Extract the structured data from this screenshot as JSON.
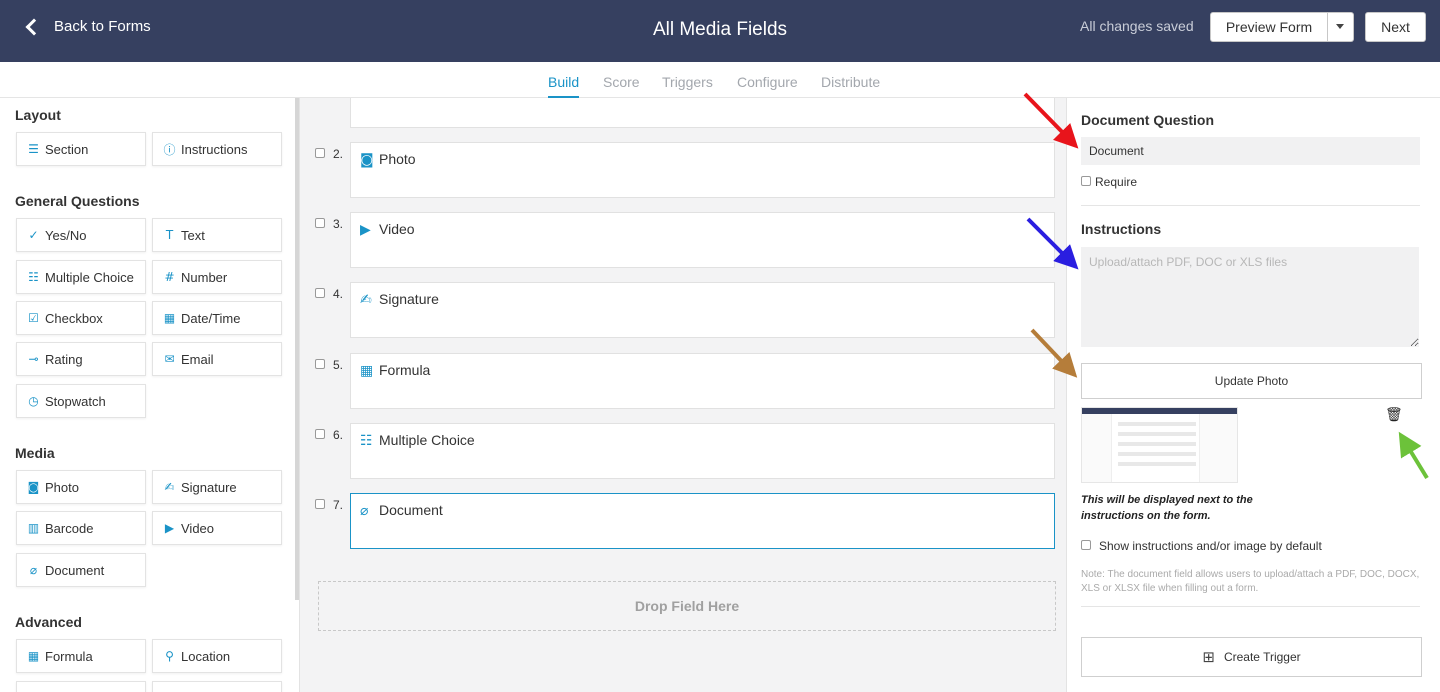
{
  "header": {
    "back_label": "Back to Forms",
    "title": "All Media Fields",
    "status": "All changes saved",
    "preview_label": "Preview Form",
    "next_label": "Next"
  },
  "tabs": [
    {
      "label": "Build",
      "active": true
    },
    {
      "label": "Score",
      "active": false
    },
    {
      "label": "Triggers",
      "active": false
    },
    {
      "label": "Configure",
      "active": false
    },
    {
      "label": "Distribute",
      "active": false
    }
  ],
  "sidebar": {
    "sections": [
      {
        "title": "Layout",
        "items": [
          {
            "label": "Section",
            "icon": "section-icon"
          },
          {
            "label": "Instructions",
            "icon": "info-icon"
          }
        ]
      },
      {
        "title": "General Questions",
        "items": [
          {
            "label": "Yes/No",
            "icon": "yes-no-icon"
          },
          {
            "label": "Text",
            "icon": "text-icon"
          },
          {
            "label": "Multiple Choice",
            "icon": "list-icon"
          },
          {
            "label": "Number",
            "icon": "hash-icon"
          },
          {
            "label": "Checkbox",
            "icon": "checkbox-icon"
          },
          {
            "label": "Date/Time",
            "icon": "calendar-icon"
          },
          {
            "label": "Rating",
            "icon": "rating-icon"
          },
          {
            "label": "Email",
            "icon": "email-icon"
          },
          {
            "label": "Stopwatch",
            "icon": "stopwatch-icon"
          }
        ]
      },
      {
        "title": "Media",
        "items": [
          {
            "label": "Photo",
            "icon": "camera-icon"
          },
          {
            "label": "Signature",
            "icon": "signature-icon"
          },
          {
            "label": "Barcode",
            "icon": "barcode-icon"
          },
          {
            "label": "Video",
            "icon": "video-icon"
          },
          {
            "label": "Document",
            "icon": "paperclip-icon"
          }
        ]
      },
      {
        "title": "Advanced",
        "items": [
          {
            "label": "Formula",
            "icon": "formula-icon"
          },
          {
            "label": "Location",
            "icon": "location-icon"
          }
        ]
      }
    ]
  },
  "canvas": {
    "questions": [
      {
        "number": "2.",
        "label": "Photo",
        "icon": "camera-icon"
      },
      {
        "number": "3.",
        "label": "Video",
        "icon": "video-icon"
      },
      {
        "number": "4.",
        "label": "Signature",
        "icon": "signature-icon"
      },
      {
        "number": "5.",
        "label": "Formula",
        "icon": "formula-icon"
      },
      {
        "number": "6.",
        "label": "Multiple Choice",
        "icon": "list-icon"
      },
      {
        "number": "7.",
        "label": "Document",
        "icon": "paperclip-icon",
        "selected": true
      }
    ],
    "drop_label": "Drop Field Here"
  },
  "panel": {
    "question_title": "Document Question",
    "question_value": "Document",
    "require_label": "Require",
    "instructions_title": "Instructions",
    "instructions_placeholder": "Upload/attach PDF, DOC or XLS files",
    "update_photo_label": "Update Photo",
    "caption": "This will be displayed next to the instructions on the form.",
    "show_default_label": "Show instructions and/or image by default",
    "note": "Note: The document field allows users to upload/attach a PDF, DOC, DOCX, XLS or XLSX file when filling out a form.",
    "create_trigger_label": "Create Trigger"
  },
  "colors": {
    "header_bg": "#364060",
    "accent": "#1a93c7",
    "arrow_red": "#e8141b",
    "arrow_blue": "#2a1ee0",
    "arrow_brown": "#b57d3a",
    "arrow_green": "#6cc23a"
  }
}
